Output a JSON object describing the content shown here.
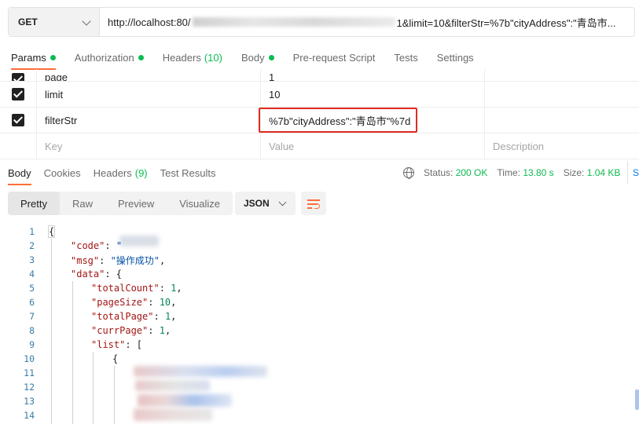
{
  "request": {
    "method": "GET",
    "url_prefix": "http://localhost:80/",
    "url_suffix": "1&limit=10&filterStr=%7b\"cityAddress\":\"青岛市..."
  },
  "request_tabs": [
    {
      "label": "Params",
      "dot": true
    },
    {
      "label": "Authorization",
      "dot": true
    },
    {
      "label": "Headers",
      "count": "(10)"
    },
    {
      "label": "Body",
      "dot": true
    },
    {
      "label": "Pre-request Script"
    },
    {
      "label": "Tests"
    },
    {
      "label": "Settings"
    }
  ],
  "params": {
    "rows": [
      {
        "key": "page",
        "value": "1",
        "checked": true
      },
      {
        "key": "limit",
        "value": "10",
        "checked": true
      },
      {
        "key": "filterStr",
        "value": "%7b\"cityAddress\":\"青岛市\"%7d",
        "checked": true
      }
    ],
    "placeholder": {
      "key": "Key",
      "value": "Value",
      "description": "Description"
    }
  },
  "response": {
    "tabs": [
      {
        "label": "Body"
      },
      {
        "label": "Cookies"
      },
      {
        "label": "Headers",
        "count": "(9)"
      },
      {
        "label": "Test Results"
      }
    ],
    "status_label": "Status:",
    "status_value": "200 OK",
    "time_label": "Time:",
    "time_value": "13.80 s",
    "size_label": "Size:",
    "size_value": "1.04 KB",
    "save_partial": "S"
  },
  "format_tabs": [
    "Pretty",
    "Raw",
    "Preview",
    "Visualize"
  ],
  "format_select": "JSON",
  "code_lines": [
    {
      "n": "1",
      "tokens": [
        {
          "t": "{",
          "c": "p"
        }
      ]
    },
    {
      "n": "2",
      "tokens": [
        {
          "t": "\"code\"",
          "c": "k"
        },
        {
          "t": ": ",
          "c": "p"
        },
        {
          "t": "\"",
          "c": "s"
        }
      ]
    },
    {
      "n": "3",
      "tokens": [
        {
          "t": "\"msg\"",
          "c": "k"
        },
        {
          "t": ": ",
          "c": "p"
        },
        {
          "t": "\"操作成功\"",
          "c": "s"
        },
        {
          "t": ",",
          "c": "p"
        }
      ]
    },
    {
      "n": "4",
      "tokens": [
        {
          "t": "\"data\"",
          "c": "k"
        },
        {
          "t": ": {",
          "c": "p"
        }
      ]
    },
    {
      "n": "5",
      "tokens": [
        {
          "t": "\"totalCount\"",
          "c": "k"
        },
        {
          "t": ": ",
          "c": "p"
        },
        {
          "t": "1",
          "c": "n"
        },
        {
          "t": ",",
          "c": "p"
        }
      ]
    },
    {
      "n": "6",
      "tokens": [
        {
          "t": "\"pageSize\"",
          "c": "k"
        },
        {
          "t": ": ",
          "c": "p"
        },
        {
          "t": "10",
          "c": "n"
        },
        {
          "t": ",",
          "c": "p"
        }
      ]
    },
    {
      "n": "7",
      "tokens": [
        {
          "t": "\"totalPage\"",
          "c": "k"
        },
        {
          "t": ": ",
          "c": "p"
        },
        {
          "t": "1",
          "c": "n"
        },
        {
          "t": ",",
          "c": "p"
        }
      ]
    },
    {
      "n": "8",
      "tokens": [
        {
          "t": "\"currPage\"",
          "c": "k"
        },
        {
          "t": ": ",
          "c": "p"
        },
        {
          "t": "1",
          "c": "n"
        },
        {
          "t": ",",
          "c": "p"
        }
      ]
    },
    {
      "n": "9",
      "tokens": [
        {
          "t": "\"list\"",
          "c": "k"
        },
        {
          "t": ": [",
          "c": "p"
        }
      ]
    },
    {
      "n": "10",
      "tokens": [
        {
          "t": "{",
          "c": "p"
        }
      ]
    },
    {
      "n": "11",
      "tokens": []
    },
    {
      "n": "12",
      "tokens": []
    },
    {
      "n": "13",
      "tokens": []
    },
    {
      "n": "14",
      "tokens": []
    }
  ]
}
